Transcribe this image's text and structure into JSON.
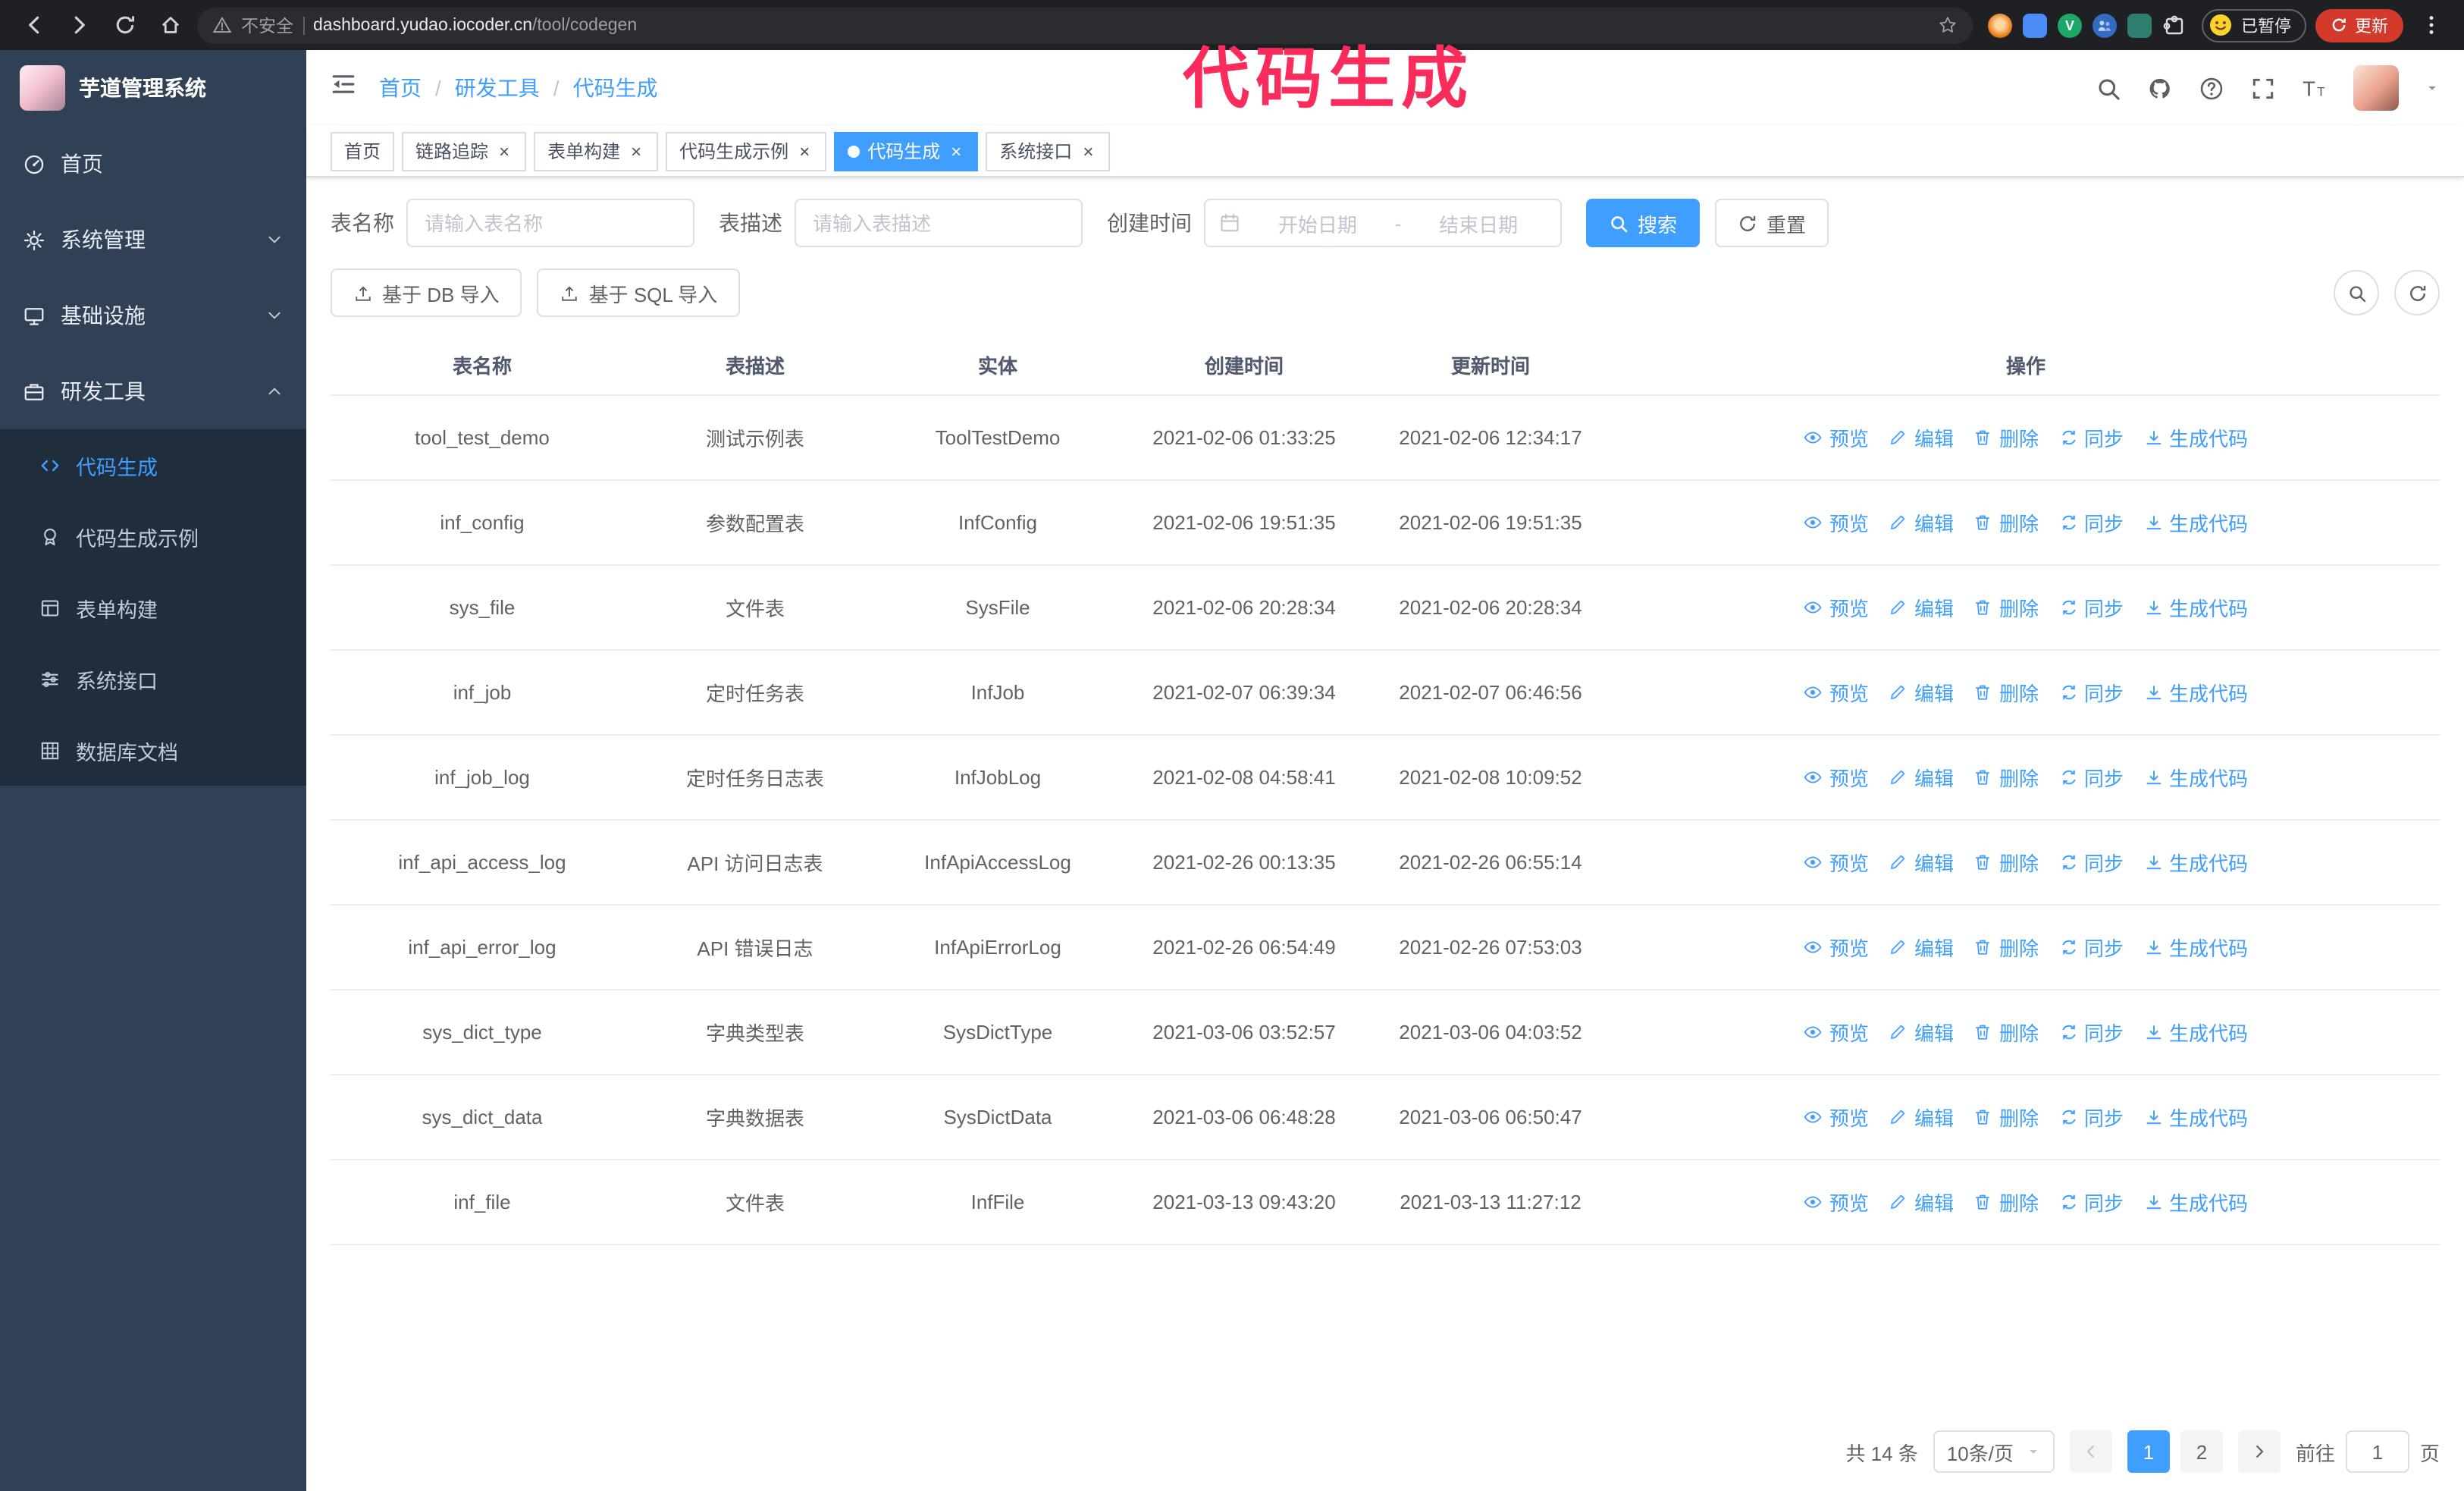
{
  "annotation": {
    "text": "代码生成"
  },
  "colors": {
    "accent": "#409eff",
    "annotation": "#fa2c5c",
    "sidebar_bg": "#304156",
    "submenu_bg": "#1f2d3d",
    "update_button": "#d33a2c"
  },
  "icons": {
    "close": "×",
    "breadcrumb_separator": "/"
  },
  "browser": {
    "security_text": "不安全",
    "url_domain": "dashboard.yudao.iocoder.cn",
    "url_path": "/tool/codegen",
    "paused_chip": "已暂停",
    "update_button": "更新"
  },
  "sidebar": {
    "logo_title": "芋道管理系统",
    "menu": [
      {
        "id": "home",
        "label": "首页",
        "icon": "dashboard"
      },
      {
        "id": "system",
        "label": "系统管理",
        "icon": "gear",
        "chevron": "down"
      },
      {
        "id": "infra",
        "label": "基础设施",
        "icon": "infra",
        "chevron": "down"
      },
      {
        "id": "devtools",
        "label": "研发工具",
        "icon": "tools",
        "chevron": "up"
      }
    ],
    "submenu": [
      {
        "id": "codegen",
        "label": "代码生成",
        "icon": "code",
        "active": true
      },
      {
        "id": "codegen-example",
        "label": "代码生成示例",
        "icon": "example"
      },
      {
        "id": "form-builder",
        "label": "表单构建",
        "icon": "form"
      },
      {
        "id": "api",
        "label": "系统接口",
        "icon": "api"
      },
      {
        "id": "db-doc",
        "label": "数据库文档",
        "icon": "db-doc"
      }
    ]
  },
  "breadcrumb": {
    "items": [
      "首页",
      "研发工具",
      "代码生成"
    ],
    "separator": "/"
  },
  "tabs": [
    {
      "id": "home",
      "label": "首页",
      "closable": false,
      "active": false
    },
    {
      "id": "tracing",
      "label": "链路追踪",
      "closable": true,
      "active": false
    },
    {
      "id": "form-builder",
      "label": "表单构建",
      "closable": true,
      "active": false
    },
    {
      "id": "codegen-example",
      "label": "代码生成示例",
      "closable": true,
      "active": false
    },
    {
      "id": "codegen",
      "label": "代码生成",
      "closable": true,
      "active": true
    },
    {
      "id": "api",
      "label": "系统接口",
      "closable": true,
      "active": false
    }
  ],
  "filters": {
    "table_name_label": "表名称",
    "table_name_placeholder": "请输入表名称",
    "table_desc_label": "表描述",
    "table_desc_placeholder": "请输入表描述",
    "create_time_label": "创建时间",
    "date_start_placeholder": "开始日期",
    "date_range_separator": "-",
    "date_end_placeholder": "结束日期",
    "search_button": "搜索",
    "reset_button": "重置"
  },
  "toolbar": {
    "import_db": "基于 DB 导入",
    "import_sql": "基于 SQL 导入"
  },
  "table": {
    "columns": [
      "表名称",
      "表描述",
      "实体",
      "创建时间",
      "更新时间",
      "操作"
    ],
    "row_actions": [
      {
        "id": "preview",
        "label": "预览",
        "icon": "eye"
      },
      {
        "id": "edit",
        "label": "编辑",
        "icon": "edit"
      },
      {
        "id": "delete",
        "label": "删除",
        "icon": "trash"
      },
      {
        "id": "sync",
        "label": "同步",
        "icon": "sync"
      },
      {
        "id": "generate",
        "label": "生成代码",
        "icon": "download"
      }
    ],
    "rows": [
      {
        "name": "tool_test_demo",
        "desc": "测试示例表",
        "entity": "ToolTestDemo",
        "created": "2021-02-06 01:33:25",
        "updated": "2021-02-06 12:34:17"
      },
      {
        "name": "inf_config",
        "desc": "参数配置表",
        "entity": "InfConfig",
        "created": "2021-02-06 19:51:35",
        "updated": "2021-02-06 19:51:35"
      },
      {
        "name": "sys_file",
        "desc": "文件表",
        "entity": "SysFile",
        "created": "2021-02-06 20:28:34",
        "updated": "2021-02-06 20:28:34"
      },
      {
        "name": "inf_job",
        "desc": "定时任务表",
        "entity": "InfJob",
        "created": "2021-02-07 06:39:34",
        "updated": "2021-02-07 06:46:56"
      },
      {
        "name": "inf_job_log",
        "desc": "定时任务日志表",
        "entity": "InfJobLog",
        "created": "2021-02-08 04:58:41",
        "updated": "2021-02-08 10:09:52"
      },
      {
        "name": "inf_api_access_log",
        "desc": "API 访问日志表",
        "entity": "InfApiAccessLog",
        "created": "2021-02-26 00:13:35",
        "updated": "2021-02-26 06:55:14"
      },
      {
        "name": "inf_api_error_log",
        "desc": "API 错误日志",
        "entity": "InfApiErrorLog",
        "created": "2021-02-26 06:54:49",
        "updated": "2021-02-26 07:53:03"
      },
      {
        "name": "sys_dict_type",
        "desc": "字典类型表",
        "entity": "SysDictType",
        "created": "2021-03-06 03:52:57",
        "updated": "2021-03-06 04:03:52"
      },
      {
        "name": "sys_dict_data",
        "desc": "字典数据表",
        "entity": "SysDictData",
        "created": "2021-03-06 06:48:28",
        "updated": "2021-03-06 06:50:47"
      },
      {
        "name": "inf_file",
        "desc": "文件表",
        "entity": "InfFile",
        "created": "2021-03-13 09:43:20",
        "updated": "2021-03-13 11:27:12"
      }
    ]
  },
  "pagination": {
    "total": "共 14 条",
    "page_size": "10条/页",
    "pages": [
      "1",
      "2"
    ],
    "active_page": "1",
    "goto_label": "前往",
    "goto_value": "1",
    "goto_suffix": "页"
  }
}
